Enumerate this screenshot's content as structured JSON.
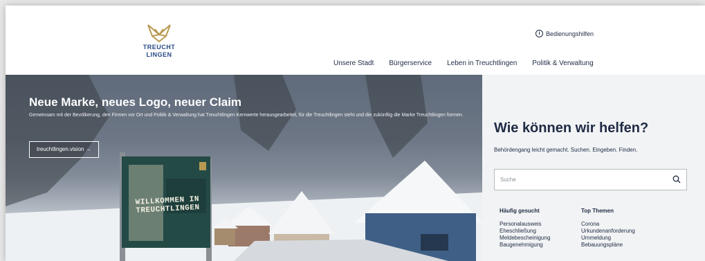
{
  "header": {
    "logo_text_1": "TREUCHT",
    "logo_text_2": "LINGEN",
    "accessibility_label": "Bedienungshilfen",
    "nav": [
      "Unsere Stadt",
      "Bürgerservice",
      "Leben in Treuchtlingen",
      "Politik & Verwaltung"
    ]
  },
  "hero": {
    "title": "Neue Marke, neues Logo, neuer Claim",
    "text": "Gemeinsam mit der Bevölkerung, den Firmen vor Ort und Politik & Verwaltung hat Treuchtlingen Kernwerte herausgearbeitet, für die Treuchtlingen steht und die zukünftig die Marke Treuchtlingen formen.",
    "button_label": "treuchtlingen.vision →",
    "billboard_line_1": "WILLKOMMEN IN",
    "billboard_line_2": "TREUCHTLINGEN"
  },
  "help": {
    "title": "Wie können wir helfen?",
    "subtitle": "Behördengang leicht gemacht. Suchen. Eingeben. Finden.",
    "search_placeholder": "Suche",
    "frequent_heading": "Häufig gesucht",
    "frequent": [
      "Personalausweis",
      "Eheschließung",
      "Meldebescheinigung",
      "Baugenehmigung"
    ],
    "topics_heading": "Top Themen",
    "topics": [
      "Corona",
      "Urkundenanforderung",
      "Ummeldung",
      "Bebauungspläne"
    ]
  },
  "colors": {
    "brand_gold": "#b99a52",
    "brand_blue": "#2a4a86",
    "text_dark": "#1f2a44",
    "panel_bg": "#f1f3f4"
  }
}
